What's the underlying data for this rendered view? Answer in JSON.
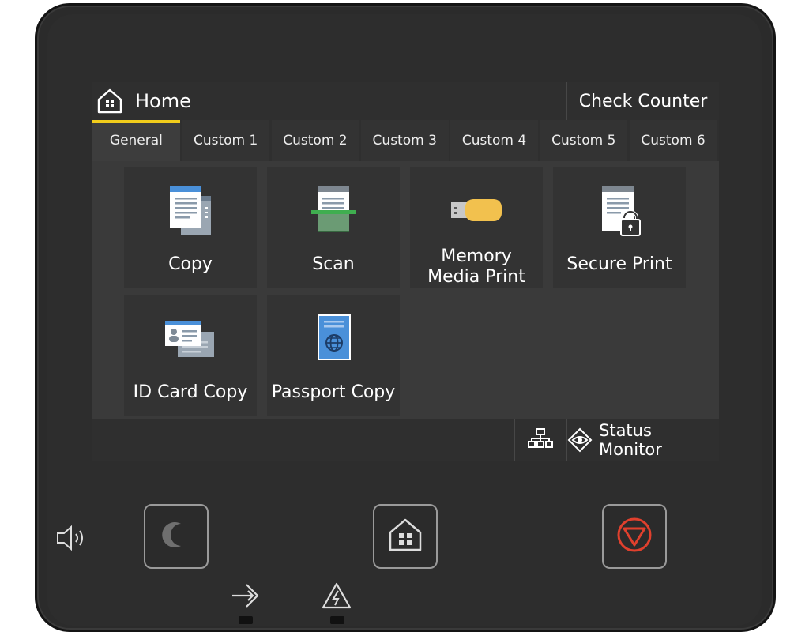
{
  "header": {
    "title": "Home",
    "check_counter_label": "Check Counter"
  },
  "tabs": [
    {
      "label": "General",
      "active": true
    },
    {
      "label": "Custom 1",
      "active": false
    },
    {
      "label": "Custom 2",
      "active": false
    },
    {
      "label": "Custom 3",
      "active": false
    },
    {
      "label": "Custom 4",
      "active": false
    },
    {
      "label": "Custom 5",
      "active": false
    },
    {
      "label": "Custom 6",
      "active": false
    }
  ],
  "tiles": [
    {
      "label": "Copy",
      "icon": "copy-icon"
    },
    {
      "label": "Scan",
      "icon": "scan-icon"
    },
    {
      "label_line1": "Memory",
      "label_line2": "Media Print",
      "icon": "usb-memory-icon"
    },
    {
      "label": "Secure Print",
      "icon": "secure-print-icon"
    },
    {
      "label": "ID Card Copy",
      "icon": "id-card-icon"
    },
    {
      "label": "Passport Copy",
      "icon": "passport-icon"
    }
  ],
  "statusbar": {
    "status_monitor_label": "Status Monitor"
  },
  "colors": {
    "accent": "#f1cc1b",
    "stop_red": "#e0402d",
    "screen_bg": "#2f2f2f"
  }
}
